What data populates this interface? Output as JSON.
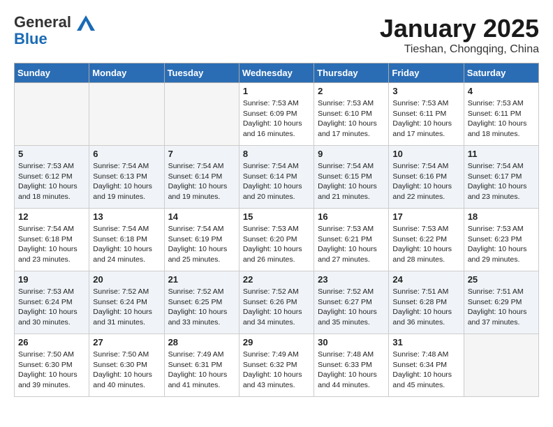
{
  "header": {
    "logo_line1": "General",
    "logo_line2": "Blue",
    "month_title": "January 2025",
    "location": "Tieshan, Chongqing, China"
  },
  "days_of_week": [
    "Sunday",
    "Monday",
    "Tuesday",
    "Wednesday",
    "Thursday",
    "Friday",
    "Saturday"
  ],
  "weeks": [
    [
      {
        "day": "",
        "sunrise": "",
        "sunset": "",
        "daylight": "",
        "empty": true
      },
      {
        "day": "",
        "sunrise": "",
        "sunset": "",
        "daylight": "",
        "empty": true
      },
      {
        "day": "",
        "sunrise": "",
        "sunset": "",
        "daylight": "",
        "empty": true
      },
      {
        "day": "1",
        "sunrise": "Sunrise: 7:53 AM",
        "sunset": "Sunset: 6:09 PM",
        "daylight": "Daylight: 10 hours and 16 minutes.",
        "empty": false
      },
      {
        "day": "2",
        "sunrise": "Sunrise: 7:53 AM",
        "sunset": "Sunset: 6:10 PM",
        "daylight": "Daylight: 10 hours and 17 minutes.",
        "empty": false
      },
      {
        "day": "3",
        "sunrise": "Sunrise: 7:53 AM",
        "sunset": "Sunset: 6:11 PM",
        "daylight": "Daylight: 10 hours and 17 minutes.",
        "empty": false
      },
      {
        "day": "4",
        "sunrise": "Sunrise: 7:53 AM",
        "sunset": "Sunset: 6:11 PM",
        "daylight": "Daylight: 10 hours and 18 minutes.",
        "empty": false
      }
    ],
    [
      {
        "day": "5",
        "sunrise": "Sunrise: 7:53 AM",
        "sunset": "Sunset: 6:12 PM",
        "daylight": "Daylight: 10 hours and 18 minutes.",
        "empty": false
      },
      {
        "day": "6",
        "sunrise": "Sunrise: 7:54 AM",
        "sunset": "Sunset: 6:13 PM",
        "daylight": "Daylight: 10 hours and 19 minutes.",
        "empty": false
      },
      {
        "day": "7",
        "sunrise": "Sunrise: 7:54 AM",
        "sunset": "Sunset: 6:14 PM",
        "daylight": "Daylight: 10 hours and 19 minutes.",
        "empty": false
      },
      {
        "day": "8",
        "sunrise": "Sunrise: 7:54 AM",
        "sunset": "Sunset: 6:14 PM",
        "daylight": "Daylight: 10 hours and 20 minutes.",
        "empty": false
      },
      {
        "day": "9",
        "sunrise": "Sunrise: 7:54 AM",
        "sunset": "Sunset: 6:15 PM",
        "daylight": "Daylight: 10 hours and 21 minutes.",
        "empty": false
      },
      {
        "day": "10",
        "sunrise": "Sunrise: 7:54 AM",
        "sunset": "Sunset: 6:16 PM",
        "daylight": "Daylight: 10 hours and 22 minutes.",
        "empty": false
      },
      {
        "day": "11",
        "sunrise": "Sunrise: 7:54 AM",
        "sunset": "Sunset: 6:17 PM",
        "daylight": "Daylight: 10 hours and 23 minutes.",
        "empty": false
      }
    ],
    [
      {
        "day": "12",
        "sunrise": "Sunrise: 7:54 AM",
        "sunset": "Sunset: 6:18 PM",
        "daylight": "Daylight: 10 hours and 23 minutes.",
        "empty": false
      },
      {
        "day": "13",
        "sunrise": "Sunrise: 7:54 AM",
        "sunset": "Sunset: 6:18 PM",
        "daylight": "Daylight: 10 hours and 24 minutes.",
        "empty": false
      },
      {
        "day": "14",
        "sunrise": "Sunrise: 7:54 AM",
        "sunset": "Sunset: 6:19 PM",
        "daylight": "Daylight: 10 hours and 25 minutes.",
        "empty": false
      },
      {
        "day": "15",
        "sunrise": "Sunrise: 7:53 AM",
        "sunset": "Sunset: 6:20 PM",
        "daylight": "Daylight: 10 hours and 26 minutes.",
        "empty": false
      },
      {
        "day": "16",
        "sunrise": "Sunrise: 7:53 AM",
        "sunset": "Sunset: 6:21 PM",
        "daylight": "Daylight: 10 hours and 27 minutes.",
        "empty": false
      },
      {
        "day": "17",
        "sunrise": "Sunrise: 7:53 AM",
        "sunset": "Sunset: 6:22 PM",
        "daylight": "Daylight: 10 hours and 28 minutes.",
        "empty": false
      },
      {
        "day": "18",
        "sunrise": "Sunrise: 7:53 AM",
        "sunset": "Sunset: 6:23 PM",
        "daylight": "Daylight: 10 hours and 29 minutes.",
        "empty": false
      }
    ],
    [
      {
        "day": "19",
        "sunrise": "Sunrise: 7:53 AM",
        "sunset": "Sunset: 6:24 PM",
        "daylight": "Daylight: 10 hours and 30 minutes.",
        "empty": false
      },
      {
        "day": "20",
        "sunrise": "Sunrise: 7:52 AM",
        "sunset": "Sunset: 6:24 PM",
        "daylight": "Daylight: 10 hours and 31 minutes.",
        "empty": false
      },
      {
        "day": "21",
        "sunrise": "Sunrise: 7:52 AM",
        "sunset": "Sunset: 6:25 PM",
        "daylight": "Daylight: 10 hours and 33 minutes.",
        "empty": false
      },
      {
        "day": "22",
        "sunrise": "Sunrise: 7:52 AM",
        "sunset": "Sunset: 6:26 PM",
        "daylight": "Daylight: 10 hours and 34 minutes.",
        "empty": false
      },
      {
        "day": "23",
        "sunrise": "Sunrise: 7:52 AM",
        "sunset": "Sunset: 6:27 PM",
        "daylight": "Daylight: 10 hours and 35 minutes.",
        "empty": false
      },
      {
        "day": "24",
        "sunrise": "Sunrise: 7:51 AM",
        "sunset": "Sunset: 6:28 PM",
        "daylight": "Daylight: 10 hours and 36 minutes.",
        "empty": false
      },
      {
        "day": "25",
        "sunrise": "Sunrise: 7:51 AM",
        "sunset": "Sunset: 6:29 PM",
        "daylight": "Daylight: 10 hours and 37 minutes.",
        "empty": false
      }
    ],
    [
      {
        "day": "26",
        "sunrise": "Sunrise: 7:50 AM",
        "sunset": "Sunset: 6:30 PM",
        "daylight": "Daylight: 10 hours and 39 minutes.",
        "empty": false
      },
      {
        "day": "27",
        "sunrise": "Sunrise: 7:50 AM",
        "sunset": "Sunset: 6:30 PM",
        "daylight": "Daylight: 10 hours and 40 minutes.",
        "empty": false
      },
      {
        "day": "28",
        "sunrise": "Sunrise: 7:49 AM",
        "sunset": "Sunset: 6:31 PM",
        "daylight": "Daylight: 10 hours and 41 minutes.",
        "empty": false
      },
      {
        "day": "29",
        "sunrise": "Sunrise: 7:49 AM",
        "sunset": "Sunset: 6:32 PM",
        "daylight": "Daylight: 10 hours and 43 minutes.",
        "empty": false
      },
      {
        "day": "30",
        "sunrise": "Sunrise: 7:48 AM",
        "sunset": "Sunset: 6:33 PM",
        "daylight": "Daylight: 10 hours and 44 minutes.",
        "empty": false
      },
      {
        "day": "31",
        "sunrise": "Sunrise: 7:48 AM",
        "sunset": "Sunset: 6:34 PM",
        "daylight": "Daylight: 10 hours and 45 minutes.",
        "empty": false
      },
      {
        "day": "",
        "sunrise": "",
        "sunset": "",
        "daylight": "",
        "empty": true
      }
    ]
  ]
}
